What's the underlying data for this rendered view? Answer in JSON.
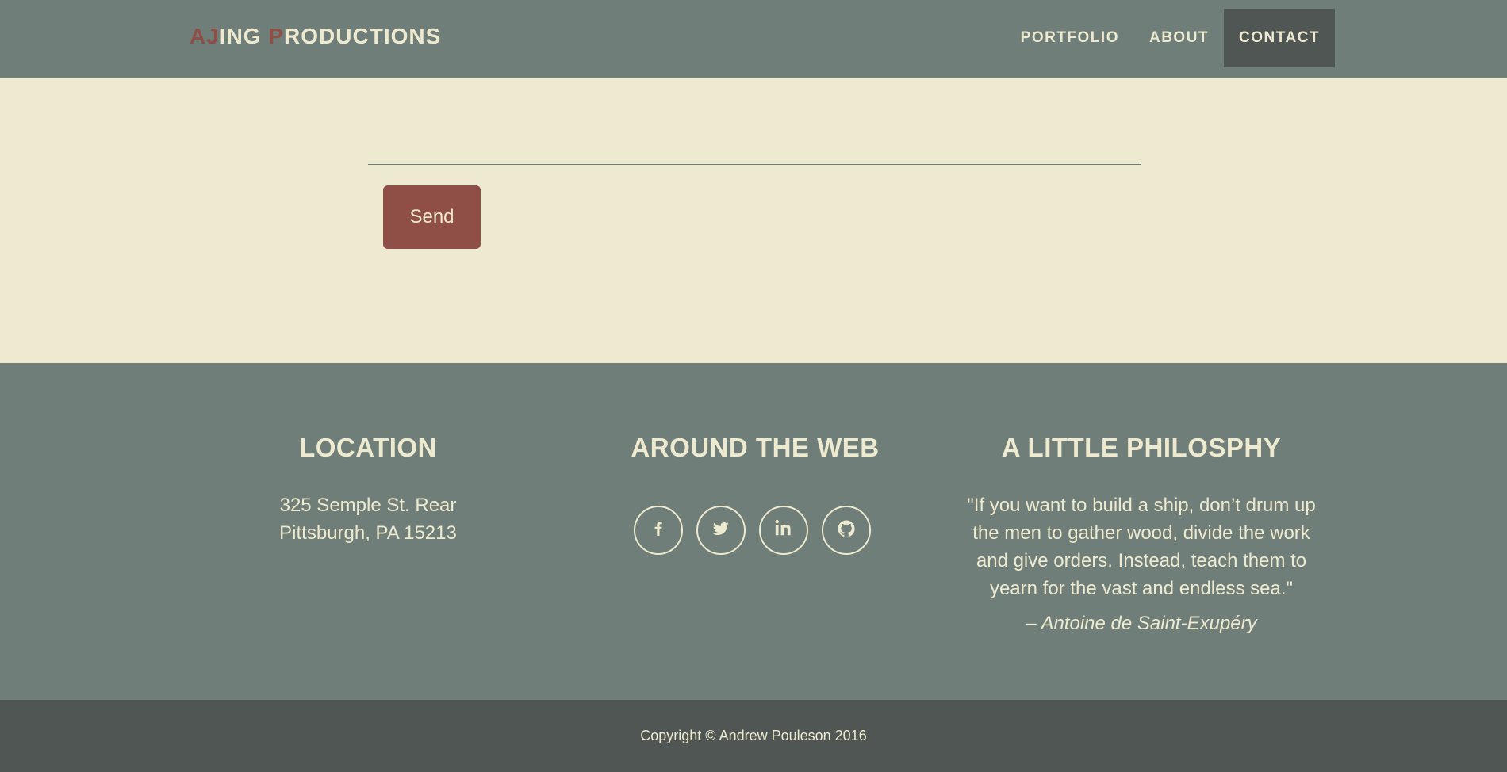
{
  "brand": {
    "part1_accent": "AJ",
    "part1_rest": "ING ",
    "part2_accent": "P",
    "part2_rest": "RODUCTIONS"
  },
  "nav": {
    "items": [
      {
        "label": "PORTFOLIO",
        "active": false
      },
      {
        "label": "ABOUT",
        "active": false
      },
      {
        "label": "CONTACT",
        "active": true
      }
    ]
  },
  "form": {
    "send_label": "Send"
  },
  "footer": {
    "location": {
      "title": "LOCATION",
      "line1": "325 Semple St. Rear",
      "line2": "Pittsburgh, PA 15213"
    },
    "web": {
      "title": "AROUND THE WEB",
      "icons": [
        "facebook-icon",
        "twitter-icon",
        "linkedin-icon",
        "github-icon"
      ]
    },
    "philosophy": {
      "title": "A LITTLE PHILOSPHY",
      "quote": "\"If you want to build a ship, don’t drum up the men to gather wood, divide the work and give orders. Instead, teach them to yearn for the vast and endless sea.\"",
      "author": "– Antoine de Saint-Exupéry"
    },
    "copyright": "Copyright © Andrew Pouleson 2016"
  },
  "colors": {
    "primary_gray": "#6f7e78",
    "dark_gray": "#4f5654",
    "cream": "#eeead0",
    "accent_red": "#8f4f46"
  }
}
